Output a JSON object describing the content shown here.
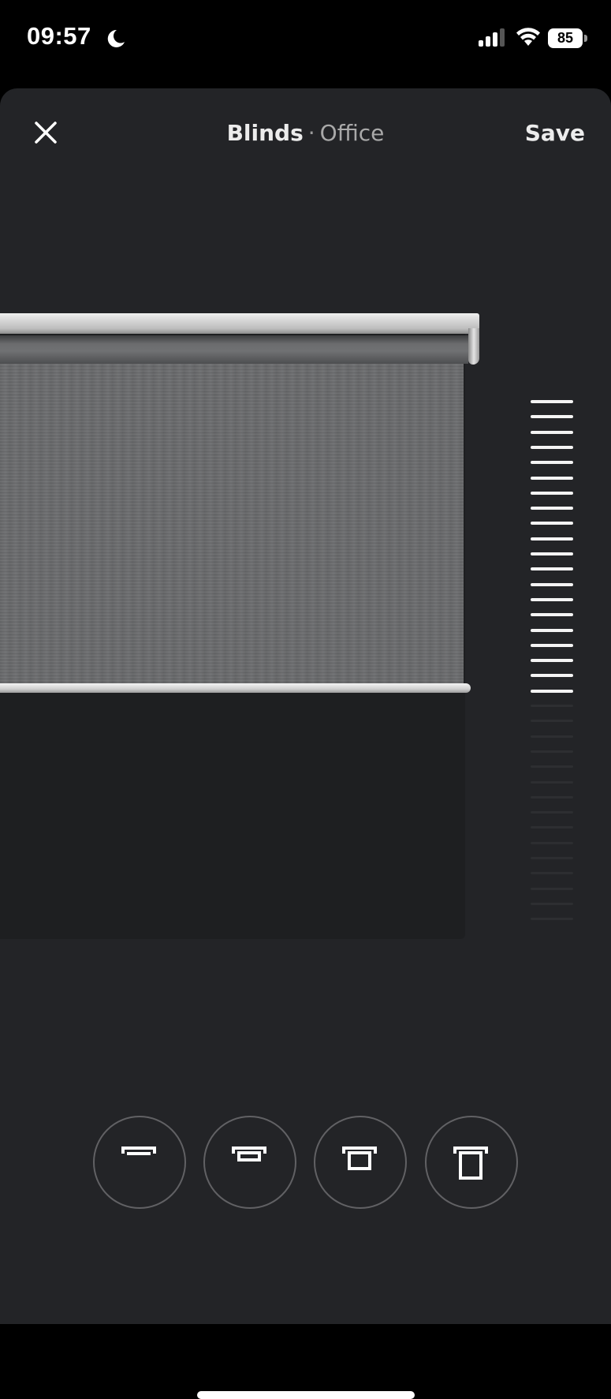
{
  "status_bar": {
    "time": "09:57",
    "focus_icon": "moon-icon",
    "signal_bars": 3,
    "signal_bars_total": 4,
    "wifi": "wifi-icon",
    "battery_percent": "85"
  },
  "header": {
    "close_icon": "close-icon",
    "title": "Blinds",
    "separator": "·",
    "subtitle": "Office",
    "save_label": "Save"
  },
  "blind": {
    "position_closed_fraction": 0.57,
    "fabric_color": "#6a6b6d",
    "window_color": "#1e1f21"
  },
  "slider": {
    "total_ticks": 35,
    "active_ticks": 20,
    "active_color": "#f4f4f4",
    "inactive_color": "#2d2e31"
  },
  "presets": [
    {
      "name": "preset-open",
      "icon": "blind-open-icon",
      "closed_fraction": 0.0
    },
    {
      "name": "preset-quarter",
      "icon": "blind-quarter-icon",
      "closed_fraction": 0.25
    },
    {
      "name": "preset-half",
      "icon": "blind-half-icon",
      "closed_fraction": 0.5
    },
    {
      "name": "preset-closed",
      "icon": "blind-closed-icon",
      "closed_fraction": 1.0
    }
  ],
  "colors": {
    "sheet_background": "#232427",
    "status_bar_background": "#000000",
    "text_primary": "#ececec",
    "text_secondary": "#a9a9a9",
    "preset_ring": "#616164"
  }
}
